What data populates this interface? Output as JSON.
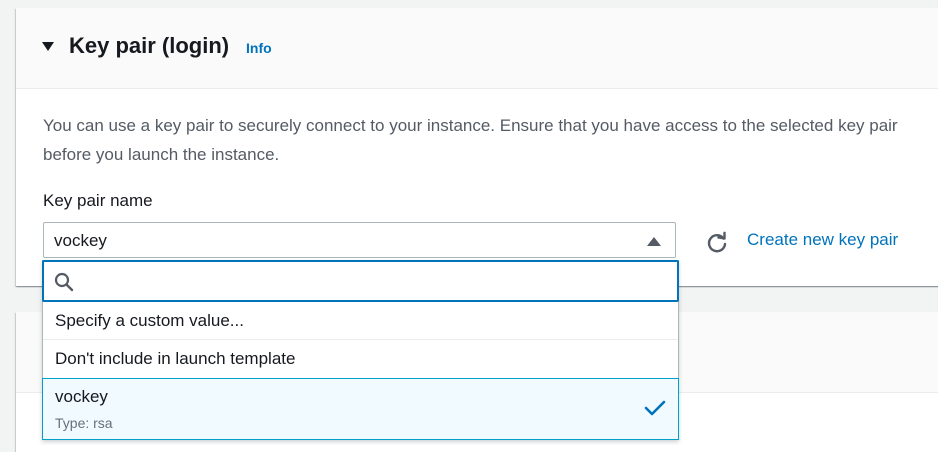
{
  "section": {
    "title": "Key pair (login)",
    "info_link": "Info",
    "description": "You can use a key pair to securely connect to your instance. Ensure that you have access to the selected key pair before you launch the instance."
  },
  "key_pair_field": {
    "label": "Key pair name",
    "selected_value": "vockey",
    "create_link": "Create new key pair"
  },
  "dropdown": {
    "search_placeholder": "",
    "options": [
      {
        "label": "Specify a custom value..."
      },
      {
        "label": "Don't include in launch template"
      },
      {
        "label": "vockey",
        "sublabel": "Type: rsa",
        "selected": true
      }
    ]
  },
  "colors": {
    "link": "#0073bb",
    "focus_border": "#0073bb",
    "selected_bg": "#f1faff",
    "selected_border": "#00a1c9"
  },
  "icons": [
    "caret-down-icon",
    "caret-up-icon",
    "refresh-icon",
    "search-icon",
    "check-icon"
  ]
}
